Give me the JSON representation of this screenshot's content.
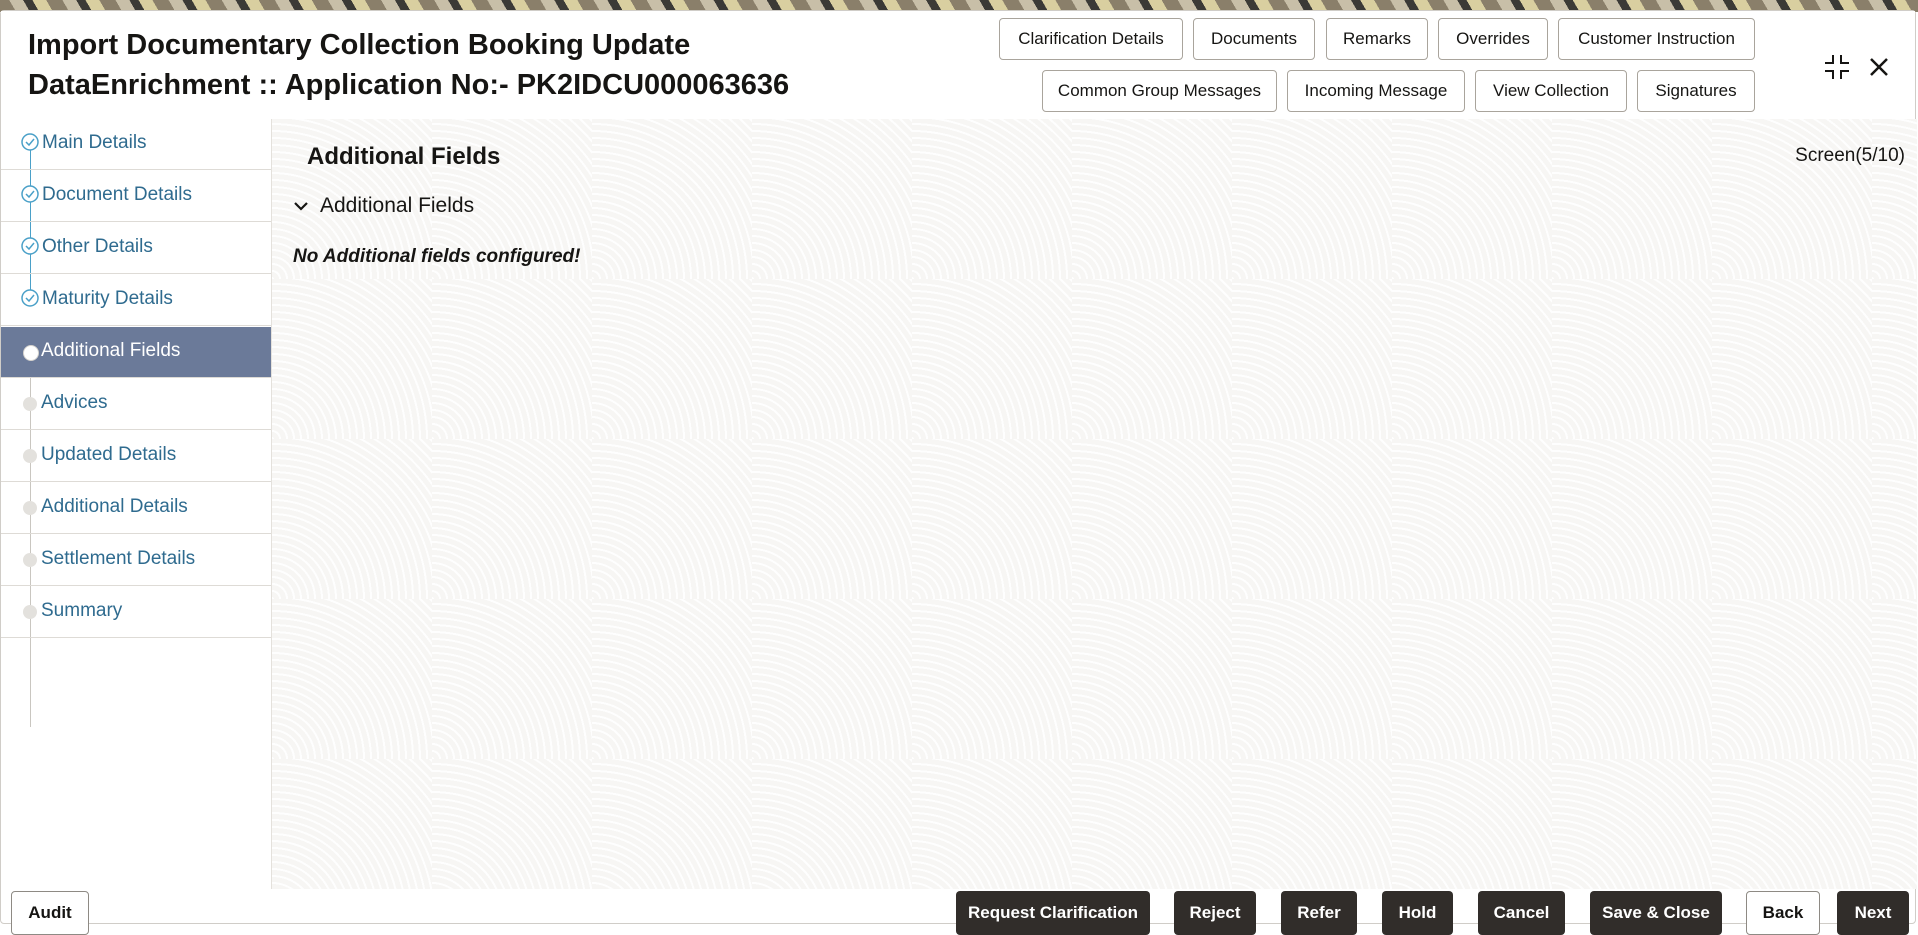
{
  "header": {
    "title_line1": "Import Documentary Collection Booking Update",
    "title_line2": "DataEnrichment :: Application No:- PK2IDCU000063636",
    "buttons_row1": [
      "Clarification Details",
      "Documents",
      "Remarks",
      "Overrides",
      "Customer Instruction"
    ],
    "buttons_row2": [
      "Common Group Messages",
      "Incoming Message",
      "View Collection",
      "Signatures"
    ],
    "icons": [
      "collapse-icon",
      "close-icon"
    ]
  },
  "sidebar": {
    "items": [
      {
        "label": "Main Details",
        "state": "completed"
      },
      {
        "label": "Document Details",
        "state": "completed"
      },
      {
        "label": "Other Details",
        "state": "completed"
      },
      {
        "label": "Maturity Details",
        "state": "completed"
      },
      {
        "label": "Additional Fields",
        "state": "active"
      },
      {
        "label": "Advices",
        "state": "pending"
      },
      {
        "label": "Updated Details",
        "state": "pending"
      },
      {
        "label": "Additional Details",
        "state": "pending"
      },
      {
        "label": "Settlement Details",
        "state": "pending"
      },
      {
        "label": "Summary",
        "state": "pending"
      }
    ]
  },
  "main": {
    "section_title": "Additional Fields",
    "screen_indicator": "Screen(5/10)",
    "panel_title": "Additional Fields",
    "empty_message": "No Additional fields configured!"
  },
  "footer": {
    "audit": "Audit",
    "request_clarification": "Request Clarification",
    "reject": "Reject",
    "refer": "Refer",
    "hold": "Hold",
    "cancel": "Cancel",
    "save_close": "Save & Close",
    "back": "Back",
    "next": "Next"
  },
  "colors": {
    "active_nav_bg": "#6b7a99",
    "nav_link": "#2f6b8f",
    "primary_button": "#312d2a",
    "step_line_done": "#4aa0c8"
  }
}
